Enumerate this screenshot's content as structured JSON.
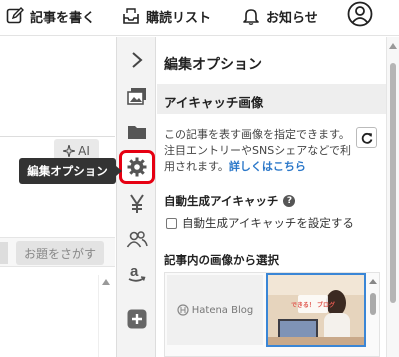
{
  "header": {
    "write_label": "記事を書く",
    "subscribe_label": "購読リスト",
    "news_label": "お知らせ"
  },
  "editor": {
    "ai_label": "AI",
    "topic_search_label": "お題をさがす"
  },
  "tooltip": {
    "text": "編集オプション"
  },
  "panel": {
    "title": "編集オプション",
    "eyecatch_section": "アイキャッチ画像",
    "description": "この記事を表す画像を指定できます。注目エントリーやSNSシェアなどで利用されます。",
    "detail_link": "詳しくはこちら",
    "auto_generate_heading": "自動生成アイキャッチ",
    "auto_generate_checkbox": "自動生成アイキャッチを設定する",
    "select_from_article": "記事内の画像から選択",
    "thumb1_text": "Hatena Blog",
    "thumb2_text": "できる！ ブログ"
  },
  "icons": {
    "collapse": "chevron-right-icon",
    "images": "images-icon",
    "folder": "folder-icon",
    "settings": "gear-icon",
    "yen": "yen-icon",
    "users": "people-icon",
    "amazon": "amazon-icon",
    "plus": "plus-icon"
  },
  "colors": {
    "highlight": "#e60012",
    "link": "#2c78c9",
    "selected_border": "#3a86d6"
  }
}
